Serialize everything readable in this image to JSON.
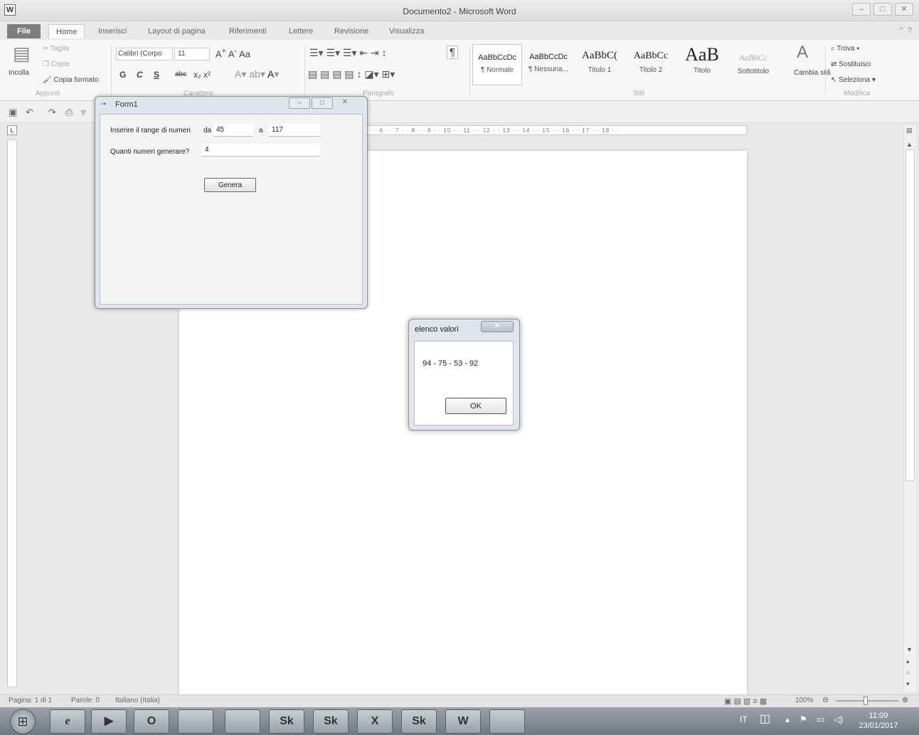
{
  "window": {
    "app_icon": "W",
    "title": "Documento2 - Microsoft Word",
    "controls": [
      "–",
      "□",
      "✕"
    ]
  },
  "ribbon_tabs": [
    "File",
    "Home",
    "Inserisci",
    "Layout di pagina",
    "Riferimenti",
    "Lettere",
    "Revisione",
    "Visualizza"
  ],
  "clipboard": {
    "paste_label": "Incolla",
    "cut_label": "Taglia",
    "copy_label": "Copia",
    "format_painter_label": "Copia formato",
    "group_label": "Appunti"
  },
  "font": {
    "font_name": "Calibri (Corpo",
    "font_size": "11",
    "bold": "G",
    "italic": "C",
    "underline": "S",
    "strike": "abc",
    "group_label": "Carattere"
  },
  "paragraph": {
    "group_label": "Paragrafo",
    "show_marks": "¶"
  },
  "styles": {
    "items": [
      {
        "sample": "AaBbCcDc",
        "name": "¶ Normale"
      },
      {
        "sample": "AaBbCcDc",
        "name": "¶ Nessuna..."
      },
      {
        "sample": "AaBbC(",
        "name": "Titolo 1"
      },
      {
        "sample": "AaBbCc",
        "name": "Titolo 2"
      },
      {
        "sample": "AaB",
        "name": "Titolo"
      },
      {
        "sample": "AaBbCc",
        "name": "Sottotitolo"
      }
    ],
    "change_styles_label": "Cambia stili",
    "group_label": "Stili"
  },
  "editing": {
    "find_label": "Trova",
    "replace_label": "Sostituisci",
    "select_label": "Seleziona",
    "group_label": "Modifica"
  },
  "form1": {
    "title": "Form1",
    "range_label": "Inserire il range di numeri",
    "from_label": "da",
    "from_value": "45",
    "to_label": "a",
    "to_value": "117",
    "count_label": "Quanti numeri generare?",
    "count_value": "4",
    "generate_button": "Genera"
  },
  "msgbox": {
    "title": "elenco valori",
    "message": "94 - 75 - 53 - 92",
    "ok_button": "OK",
    "close": "✕"
  },
  "statusbar": {
    "page": "Pagina: 1 di 1",
    "words": "Parole: 0",
    "language": "Italiano (Italia)",
    "zoom": "100%"
  },
  "taskbar": {
    "buttons": [
      "e",
      "▶",
      "O",
      "",
      "",
      "Sk",
      "Sk",
      "X",
      "Sk",
      "W",
      ""
    ],
    "lang": "IT",
    "time": "11:09",
    "date": "23/01/2017"
  }
}
